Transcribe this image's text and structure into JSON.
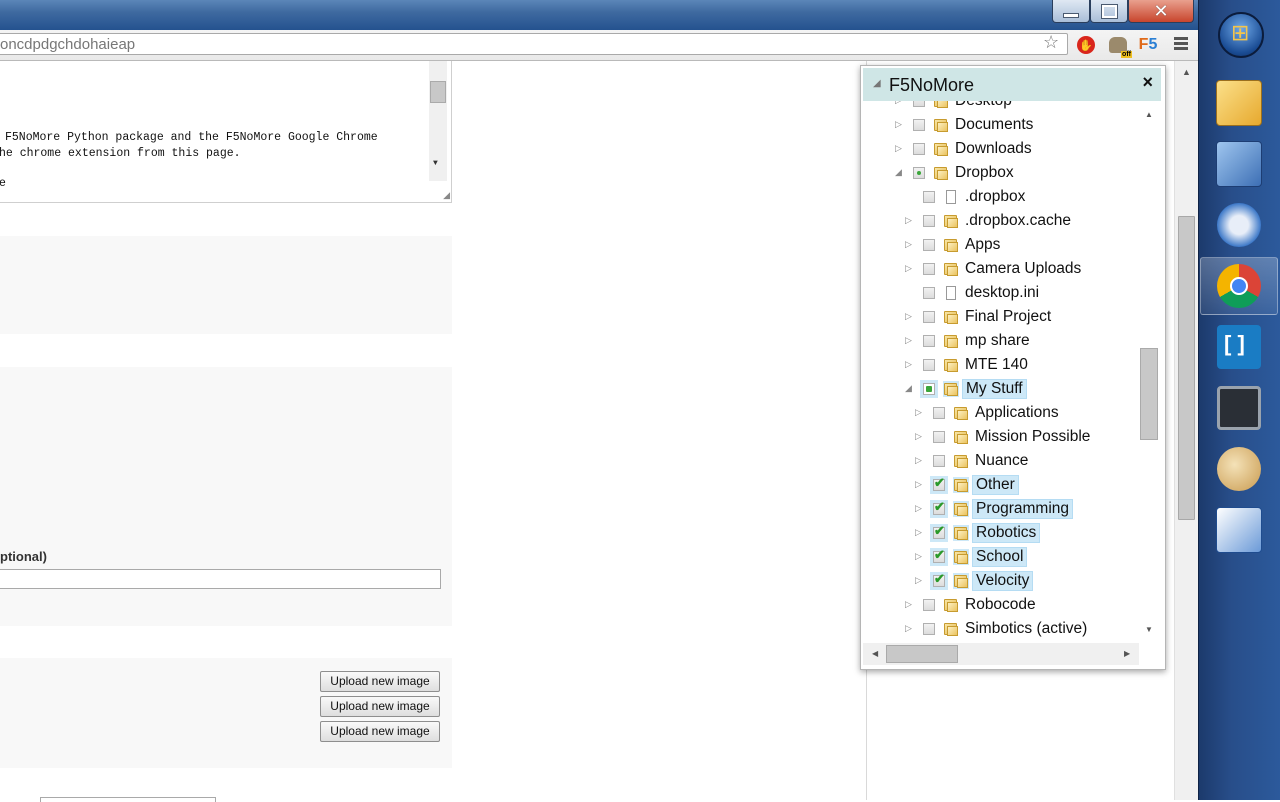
{
  "window": {
    "address_text": "oncdpdgchdohaieap",
    "ext_off_badge": "off",
    "ext_f5_prefix": "F",
    "ext_f5_suffix": "5"
  },
  "page": {
    "code_lines": [
      "F5NoMore Python package and the F5NoMore Google Chrome",
      "he chrome extension from this page.",
      "",
      "e"
    ],
    "optional_label": "ptional)",
    "upload_buttons": [
      "Upload new image",
      "Upload new image",
      "Upload new image"
    ]
  },
  "popup": {
    "title": "F5NoMore",
    "close_label": "×",
    "tree": [
      {
        "label": "Desktop",
        "type": "folder",
        "level": 0,
        "state": "none",
        "expand": "collapsed"
      },
      {
        "label": "Documents",
        "type": "folder",
        "level": 0,
        "state": "none",
        "expand": "collapsed"
      },
      {
        "label": "Downloads",
        "type": "folder",
        "level": 0,
        "state": "none",
        "expand": "collapsed"
      },
      {
        "label": "Dropbox",
        "type": "folder",
        "level": 0,
        "state": "partial-dot",
        "expand": "expanded"
      },
      {
        "label": ".dropbox",
        "type": "file",
        "level": 1,
        "state": "none",
        "expand": "none"
      },
      {
        "label": ".dropbox.cache",
        "type": "folder",
        "level": 1,
        "state": "none",
        "expand": "collapsed"
      },
      {
        "label": "Apps",
        "type": "folder",
        "level": 1,
        "state": "none",
        "expand": "collapsed"
      },
      {
        "label": "Camera Uploads",
        "type": "folder",
        "level": 1,
        "state": "none",
        "expand": "collapsed"
      },
      {
        "label": "desktop.ini",
        "type": "file",
        "level": 1,
        "state": "none",
        "expand": "none"
      },
      {
        "label": "Final Project",
        "type": "folder",
        "level": 1,
        "state": "none",
        "expand": "collapsed"
      },
      {
        "label": "mp share",
        "type": "folder",
        "level": 1,
        "state": "none",
        "expand": "collapsed"
      },
      {
        "label": "MTE 140",
        "type": "folder",
        "level": 1,
        "state": "none",
        "expand": "collapsed"
      },
      {
        "label": "My Stuff",
        "type": "folder",
        "level": 1,
        "state": "partial",
        "expand": "expanded",
        "selected": true
      },
      {
        "label": "Applications",
        "type": "folder",
        "level": 2,
        "state": "none",
        "expand": "collapsed"
      },
      {
        "label": "Mission Possible",
        "type": "folder",
        "level": 2,
        "state": "none",
        "expand": "collapsed"
      },
      {
        "label": "Nuance",
        "type": "folder",
        "level": 2,
        "state": "none",
        "expand": "collapsed"
      },
      {
        "label": "Other",
        "type": "folder",
        "level": 2,
        "state": "checked",
        "expand": "collapsed",
        "selected": true
      },
      {
        "label": "Programming",
        "type": "folder",
        "level": 2,
        "state": "checked",
        "expand": "collapsed",
        "selected": true
      },
      {
        "label": "Robotics",
        "type": "folder",
        "level": 2,
        "state": "checked",
        "expand": "collapsed",
        "selected": true
      },
      {
        "label": "School",
        "type": "folder",
        "level": 2,
        "state": "checked",
        "expand": "collapsed",
        "selected": true
      },
      {
        "label": "Velocity",
        "type": "folder",
        "level": 2,
        "state": "checked",
        "expand": "collapsed",
        "selected": true
      },
      {
        "label": "Robocode",
        "type": "folder",
        "level": 1,
        "state": "none",
        "expand": "collapsed"
      },
      {
        "label": "Simbotics (active)",
        "type": "folder",
        "level": 1,
        "state": "none",
        "expand": "collapsed"
      }
    ]
  },
  "taskbar": {
    "items": [
      {
        "icon": "windows-explorer-icon"
      },
      {
        "icon": "network-icon"
      },
      {
        "icon": "thunderbird-icon"
      },
      {
        "icon": "chrome-icon",
        "active": true
      },
      {
        "icon": "brackets-editor-icon"
      },
      {
        "icon": "terminal-monitor-icon"
      },
      {
        "icon": "paint-palette-icon"
      },
      {
        "icon": "drawing-tool-icon"
      }
    ]
  }
}
